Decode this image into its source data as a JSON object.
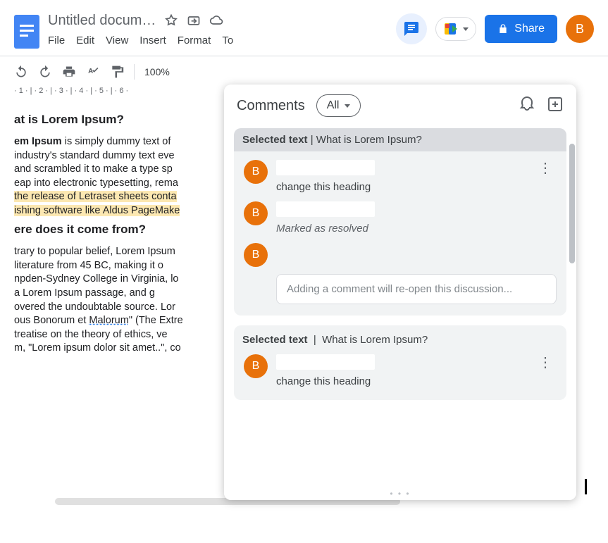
{
  "header": {
    "title": "Untitled document",
    "menu": {
      "file": "File",
      "edit": "Edit",
      "view": "View",
      "insert": "Insert",
      "format": "Format",
      "tools_clip": "To"
    },
    "share_label": "Share",
    "avatar_initial": "B"
  },
  "toolbar": {
    "zoom": "100%"
  },
  "ruler": "·  1  ·  |  ·  2  ·  |  ·  3  ·  |  ·  4  ·  |  ·  5  ·  |  ·  6  ·",
  "document": {
    "h1": "at is Lorem Ipsum?",
    "p1a": "em Ipsum",
    "p1b": " is simply dummy text of",
    "p1c": " industry's standard dummy text eve",
    "p1d": " and scrambled it to make a type sp",
    "p1e": "eap into electronic typesetting, rema",
    "p1f": " the release of Letraset sheets conta",
    "p1g": "ishing software like Aldus PageMake",
    "h2": "ere does it come from?",
    "p2a": "trary to popular belief, Lorem Ipsum",
    "p2b": " literature from 45 BC, making it o",
    "p2c": "npden-Sydney College in Virginia, lo",
    "p2d": " a Lorem Ipsum passage, and g",
    "p2e": "overed the undoubtable source. Lor",
    "p2f": "ous Bonorum et ",
    "p2f_sq": "Malorum",
    "p2f_end": "\" (The Extre",
    "p2g": " treatise on the theory of ethics, ve",
    "p2h": "m, \"Lorem ipsum dolor sit amet..\", co"
  },
  "panel": {
    "title": "Comments",
    "filter": "All",
    "thread1": {
      "selected_label": "Selected text",
      "selected_text": "What is Lorem Ipsum?",
      "author_initial": "B",
      "comment_text": "change this heading",
      "resolved_by_initial": "B",
      "resolved_status": "Marked as resolved",
      "reply_placeholder": "Adding a comment will re-open this discussion..."
    },
    "thread2": {
      "selected_label": "Selected text",
      "selected_text": "What is Lorem Ipsum?",
      "author_initial": "B",
      "comment_text": "change this heading"
    }
  }
}
